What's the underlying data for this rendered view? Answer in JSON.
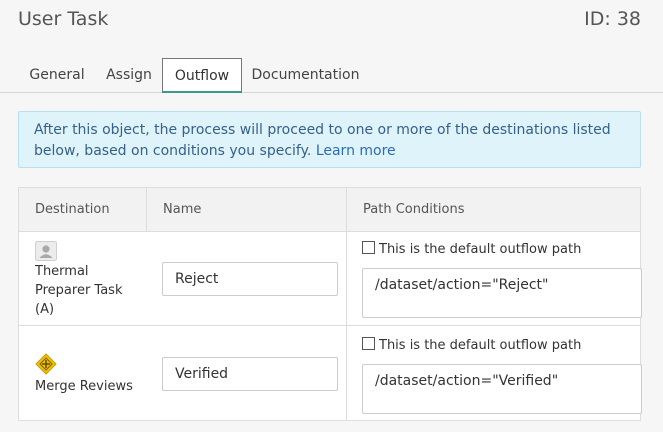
{
  "header": {
    "title": "User Task",
    "id_label": "ID: 38"
  },
  "tabs": [
    {
      "label": "General"
    },
    {
      "label": "Assign"
    },
    {
      "label": "Outflow",
      "active": true
    },
    {
      "label": "Documentation"
    }
  ],
  "info": {
    "text": "After this object, the process will proceed to one or more of the destinations listed below, based on conditions you specify.",
    "link": "Learn more"
  },
  "table": {
    "headers": [
      "Destination",
      "Name",
      "Path Conditions"
    ],
    "rows": [
      {
        "destination": "Thermal Preparer Task (A)",
        "destination_icon": "user-task-icon",
        "name": "Reject",
        "default_label": "This is the default outflow path",
        "default_checked": false,
        "condition": "/dataset/action=\"Reject\""
      },
      {
        "destination": "Merge Reviews",
        "destination_icon": "gateway-icon",
        "name": "Verified",
        "default_label": "This is the default outflow path",
        "default_checked": false,
        "condition": "/dataset/action=\"Verified\""
      }
    ]
  },
  "colors": {
    "active_tab_underline": "#3a9a8e",
    "info_background": "#dff3fa",
    "info_text": "#35618a",
    "gateway_icon": "#f2c200"
  }
}
